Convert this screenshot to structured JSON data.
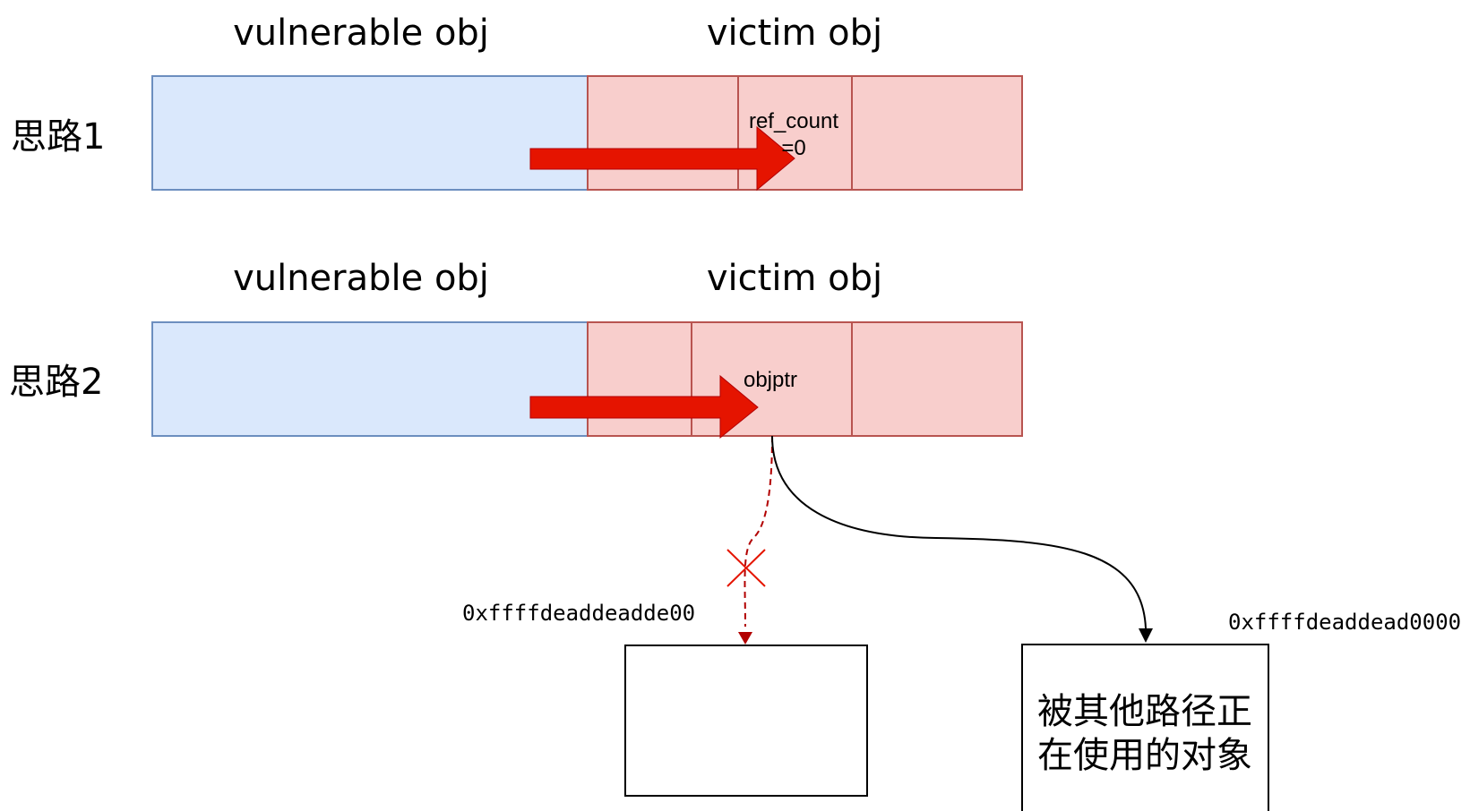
{
  "rows": [
    {
      "label": "思路1",
      "vulnerable_title": "vulnerable obj",
      "victim_title": "victim obj",
      "field_label_line1": "ref_count",
      "field_label_line2": "=0"
    },
    {
      "label": "思路2",
      "vulnerable_title": "vulnerable obj",
      "victim_title": "victim obj",
      "field_label": "objptr"
    }
  ],
  "targets": {
    "fake_address": "0xffffdeaddeadde00",
    "real_address": "0xffffdeaddead0000",
    "real_object_text_line1": "被其他路径正",
    "real_object_text_line2": "在使用的对象"
  },
  "colors": {
    "vulnerable_fill": "#dae8fc",
    "vulnerable_stroke": "#6c8ebf",
    "victim_fill": "#f8cecc",
    "victim_stroke": "#b85450",
    "overflow_arrow": "#e51400",
    "dashed_path": "#b20000",
    "cross_mark": "#e51400",
    "solid_path": "#000000"
  }
}
